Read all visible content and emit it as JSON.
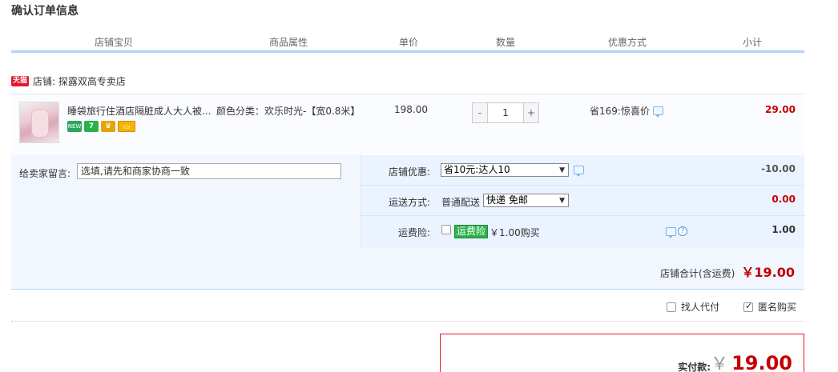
{
  "page": {
    "title": "确认订单信息"
  },
  "columns": [
    "店铺宝贝",
    "商品属性",
    "单价",
    "数量",
    "优惠方式",
    "小计"
  ],
  "shop": {
    "badge": "天猫",
    "name": "店铺: 探露双高专卖店"
  },
  "item": {
    "title": "睡袋旅行住酒店隔脏成人大人被...",
    "badge_new": "NEW",
    "badge_seven": "7",
    "attribute": "颜色分类：欢乐时光-【宽0.8米】",
    "price": "198.00",
    "quantity": "1",
    "qty_minus": "-",
    "qty_plus": "+",
    "discount": "省169:惊喜价",
    "subtotal": "29.00"
  },
  "message": {
    "label": "给卖家留言:",
    "placeholder": "选填,请先和商家协商一致"
  },
  "shop_discount": {
    "label": "店铺优惠:",
    "selected": "省10元:达人10",
    "value": "-10.00"
  },
  "shipping": {
    "label": "运送方式:",
    "type": "普通配送",
    "selected": "快递 免邮",
    "value": "0.00"
  },
  "insurance": {
    "label": "运费险:",
    "tag": "运费险",
    "price": "￥1.00购买",
    "help": "?",
    "value": "1.00"
  },
  "shop_total": {
    "label": "店铺合计(含运费)",
    "value": "￥19.00"
  },
  "options": {
    "proxy_pay": "找人代付",
    "anonymous": "匿名购买"
  },
  "payment": {
    "label": "实付款:",
    "currency": "￥",
    "value": "19.00"
  },
  "colors": {
    "accent_red": "#c40000",
    "header_line": "#b2d1ff",
    "panel_bg": "#f2f7ff",
    "tmall_red": "#e5162c"
  }
}
